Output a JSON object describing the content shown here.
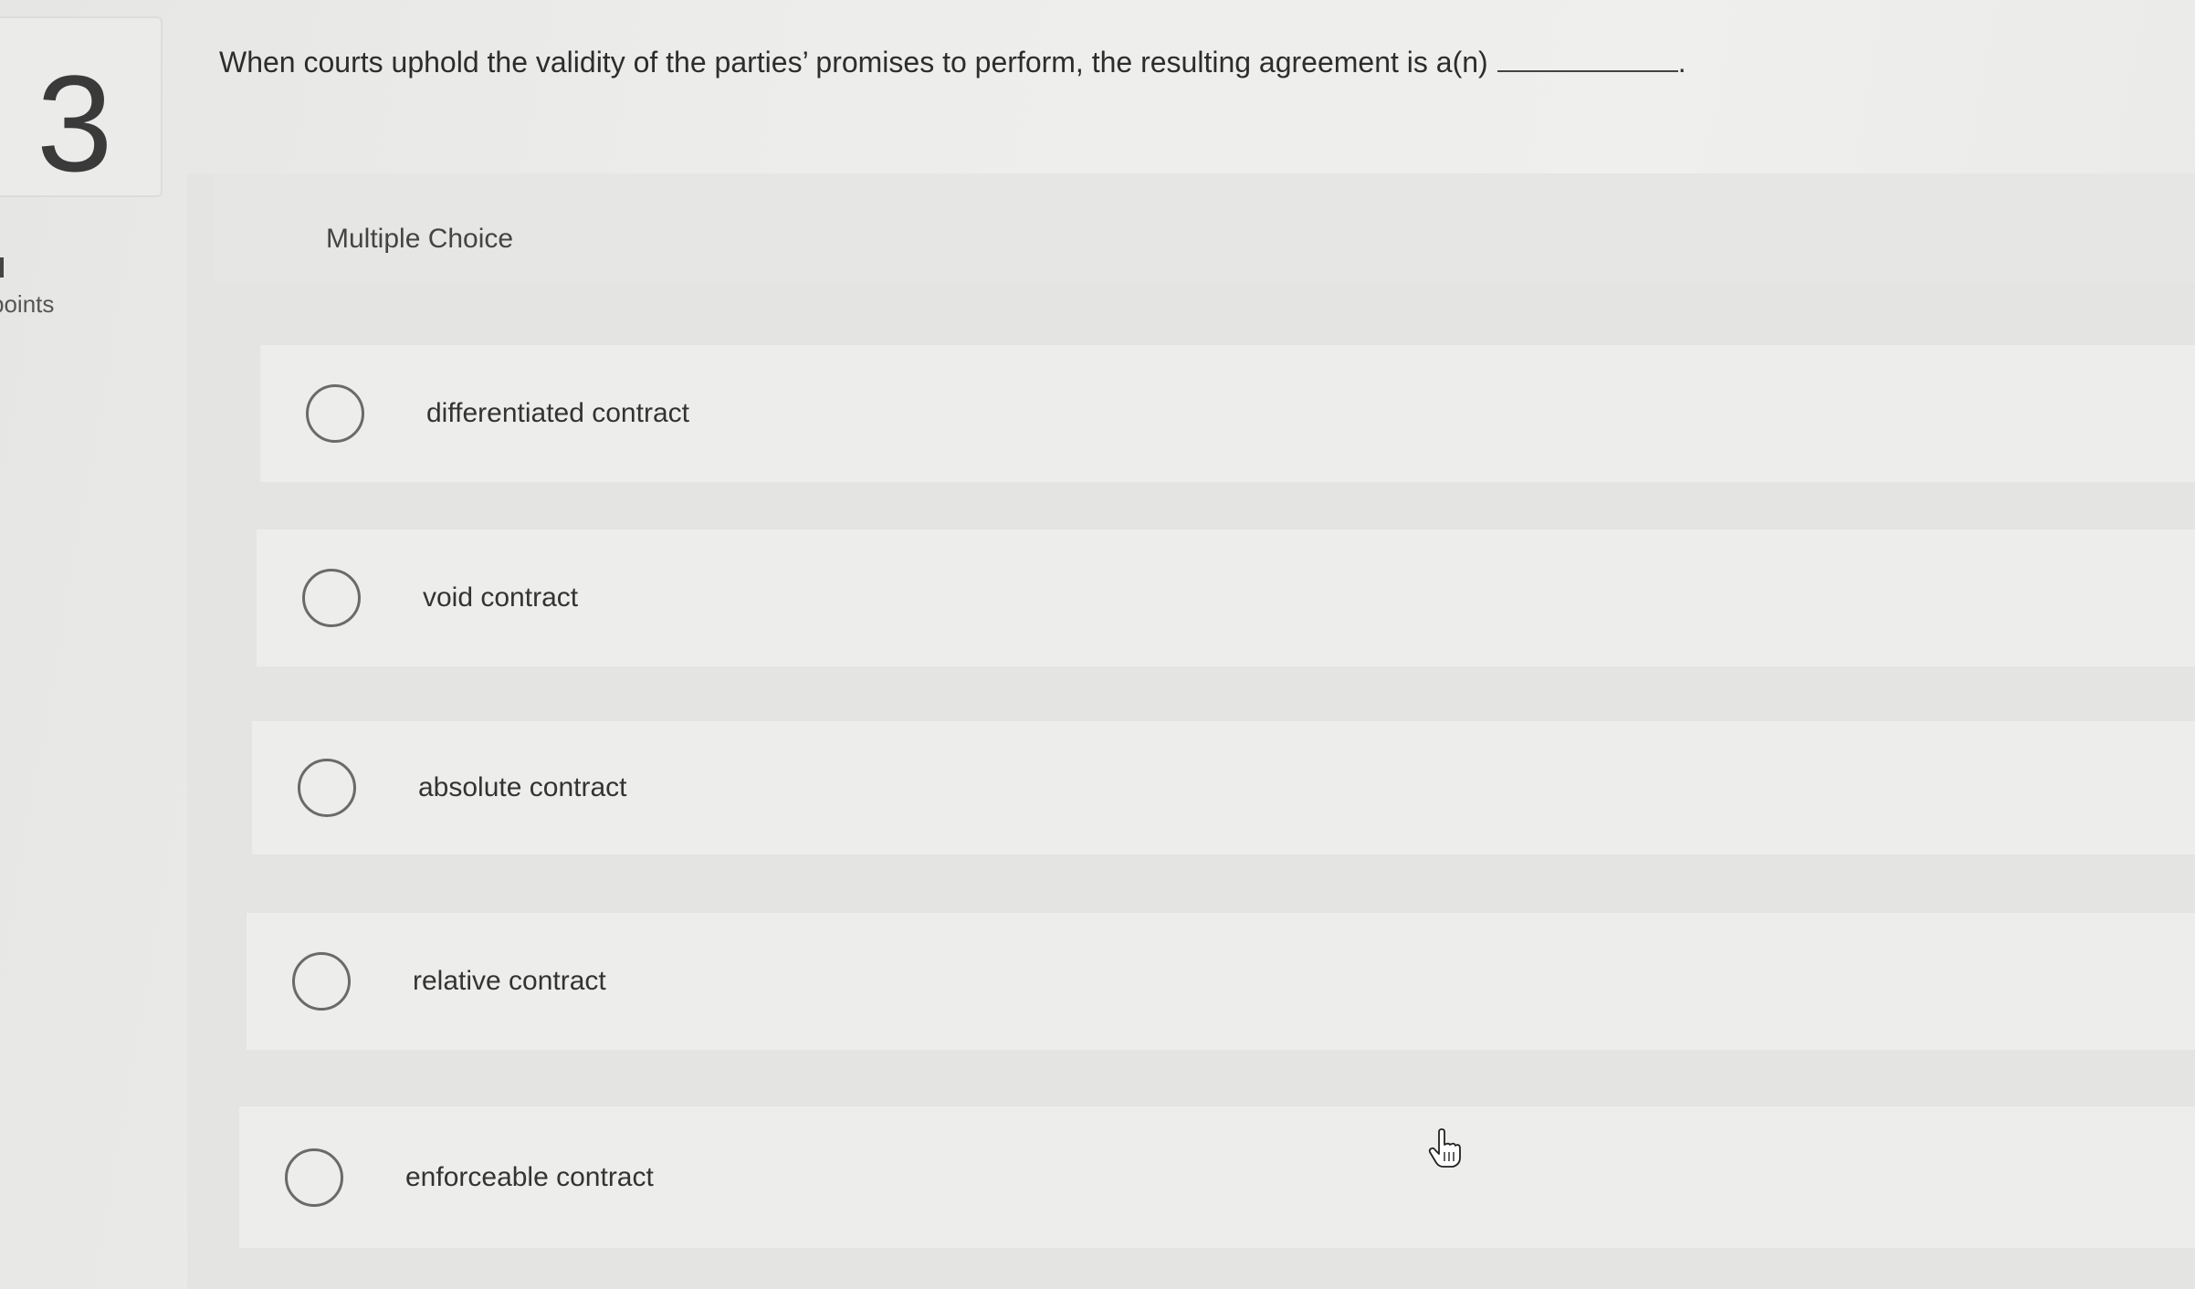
{
  "question": {
    "number": "3",
    "points_label": "points",
    "text": "When courts uphold the validity of the parties’ promises to perform, the resulting agreement is a(n)",
    "blank_end": "."
  },
  "answer_section": {
    "title": "Multiple Choice",
    "options": [
      {
        "label": "differentiated contract",
        "selected": false
      },
      {
        "label": "void contract",
        "selected": false
      },
      {
        "label": "absolute contract",
        "selected": false
      },
      {
        "label": "relative contract",
        "selected": false
      },
      {
        "label": "enforceable contract",
        "selected": false
      }
    ]
  },
  "icons": {
    "cursor": "hand-pointer-icon",
    "radio": "radio-unselected-icon"
  }
}
